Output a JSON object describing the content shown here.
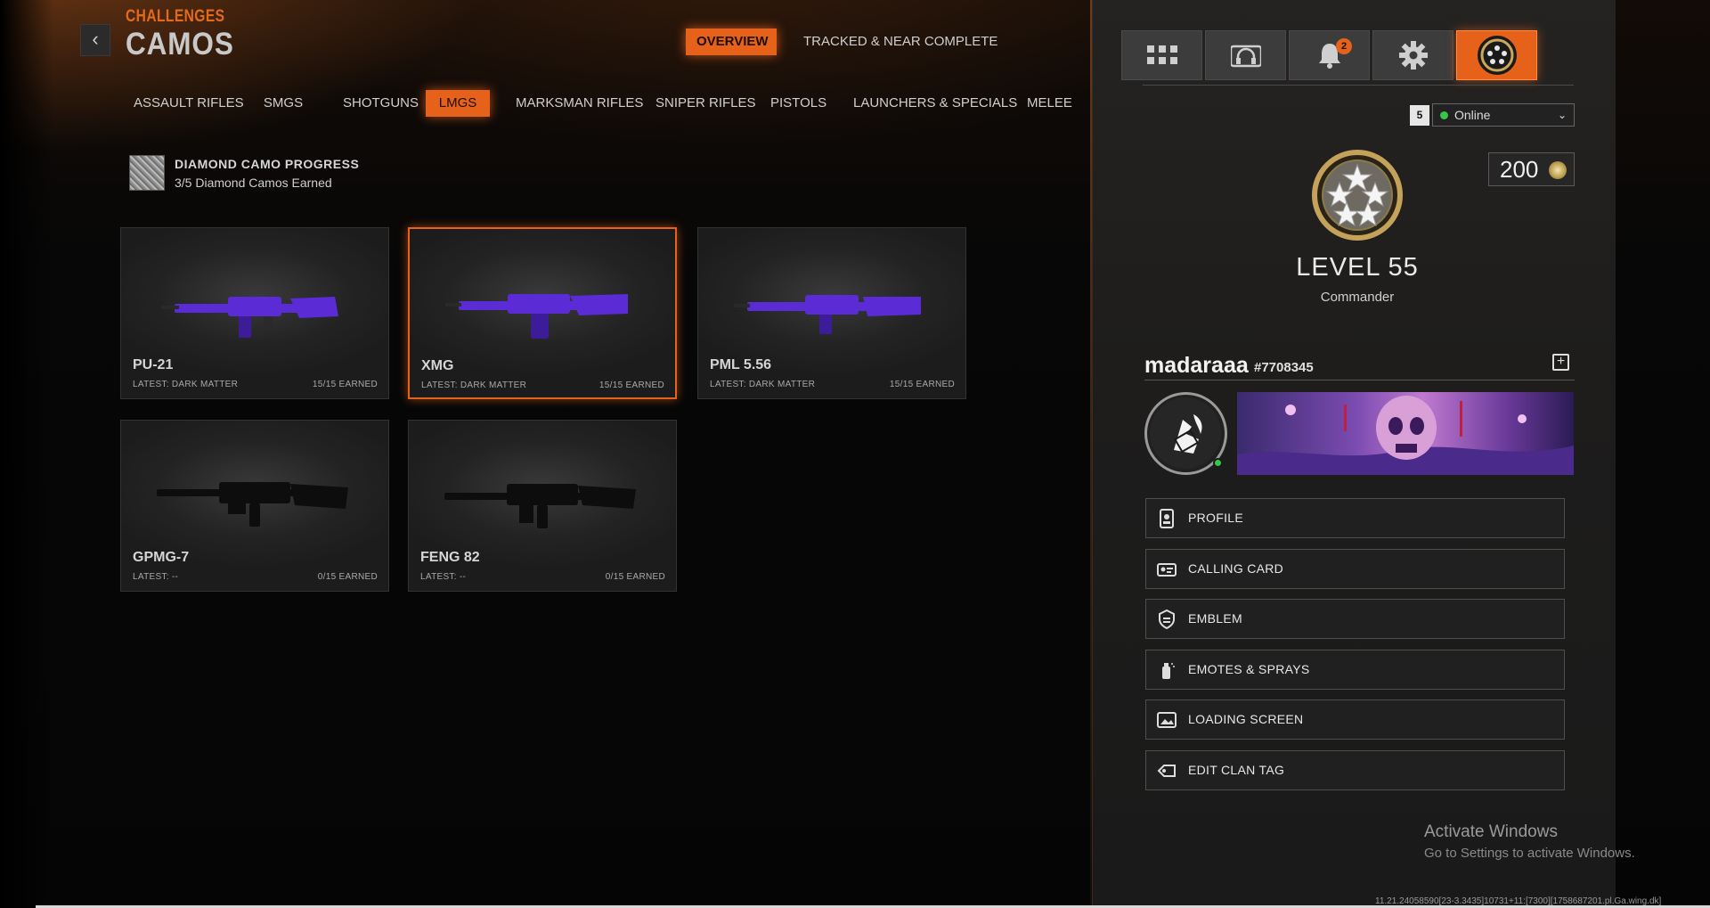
{
  "header": {
    "back_icon": "chevron-left-icon",
    "breadcrumb": "CHALLENGES",
    "title": "CAMOS",
    "tabs": [
      {
        "label": "OVERVIEW",
        "active": true
      },
      {
        "label": "TRACKED & NEAR COMPLETE",
        "active": false
      }
    ]
  },
  "categories": [
    {
      "label": "ASSAULT RIFLES",
      "active": false
    },
    {
      "label": "SMGS",
      "active": false
    },
    {
      "label": "SHOTGUNS",
      "active": false
    },
    {
      "label": "LMGS",
      "active": true
    },
    {
      "label": "MARKSMAN RIFLES",
      "active": false
    },
    {
      "label": "SNIPER RIFLES",
      "active": false
    },
    {
      "label": "PISTOLS",
      "active": false
    },
    {
      "label": "LAUNCHERS & SPECIALS",
      "active": false
    },
    {
      "label": "MELEE",
      "active": false
    }
  ],
  "diamond": {
    "title": "DIAMOND CAMO PROGRESS",
    "subtitle": "3/5 Diamond Camos Earned"
  },
  "weapons": [
    {
      "name": "PU-21",
      "latest": "LATEST: DARK MATTER",
      "earned": "15/15 EARNED",
      "camo": "dark-matter",
      "selected": false
    },
    {
      "name": "XMG",
      "latest": "LATEST: DARK MATTER",
      "earned": "15/15 EARNED",
      "camo": "dark-matter",
      "selected": true
    },
    {
      "name": "PML 5.56",
      "latest": "LATEST: DARK MATTER",
      "earned": "15/15 EARNED",
      "camo": "dark-matter",
      "selected": false
    },
    {
      "name": "GPMG-7",
      "latest": "LATEST: --",
      "earned": "0/15 EARNED",
      "camo": "none",
      "selected": false
    },
    {
      "name": "FENG 82",
      "latest": "LATEST: --",
      "earned": "0/15 EARNED",
      "camo": "none",
      "selected": false
    }
  ],
  "panel": {
    "icons": [
      "grid-icon",
      "headset-icon",
      "bell-icon",
      "gear-icon",
      "rank-badge-icon"
    ],
    "notification_count": "2",
    "party_size": "5",
    "status": "Online",
    "currency": "200",
    "level": "LEVEL 55",
    "rank": "Commander",
    "player_name": "madaraaa",
    "player_tag": "#7708345",
    "menu": [
      {
        "label": "PROFILE",
        "icon": "profile-icon"
      },
      {
        "label": "CALLING CARD",
        "icon": "calling-card-icon"
      },
      {
        "label": "EMBLEM",
        "icon": "emblem-icon"
      },
      {
        "label": "EMOTES & SPRAYS",
        "icon": "spray-icon"
      },
      {
        "label": "LOADING SCREEN",
        "icon": "loading-screen-icon"
      },
      {
        "label": "EDIT CLAN TAG",
        "icon": "clan-tag-icon"
      }
    ]
  },
  "watermark": {
    "title": "Activate Windows",
    "subtitle": "Go to Settings to activate Windows."
  },
  "debug_text": "11.21.24058590[23-3.3435]10731+11:[7300][1758687201.pl.Ga.wing.dk]",
  "colors": {
    "accent": "#e6621a",
    "camo_purple": "#5b2bd6",
    "online": "#35c94a"
  }
}
